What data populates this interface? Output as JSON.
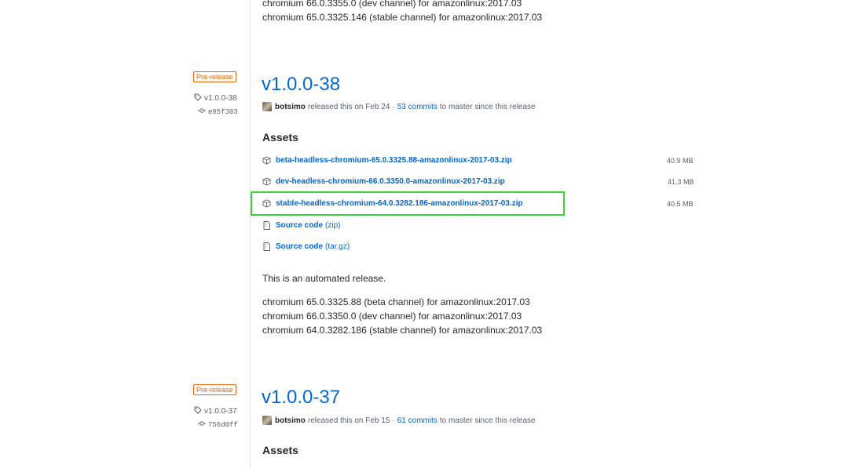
{
  "top_notes": {
    "line1": "chromium 66.0.3355.0 (dev channel) for amazonlinux:2017.03",
    "line2": "chromium 65.0.3325.146 (stable channel) for amazonlinux:2017.03"
  },
  "releases": [
    {
      "badge": "Pre-release",
      "tag": "v1.0.0-38",
      "commit": "e95f303",
      "title": "v1.0.0-38",
      "author": "botsimo",
      "released_text": "released this on Feb 24",
      "separator": "·",
      "commits_link": "53 commits",
      "since_text": "to master since this release",
      "assets_heading": "Assets",
      "assets": [
        {
          "name": "beta-headless-chromium-65.0.3325.88-amazonlinux-2017-03.zip",
          "size": "40.9 MB",
          "icon": "package-icon"
        },
        {
          "name": "dev-headless-chromium-66.0.3350.0-amazonlinux-2017-03.zip",
          "size": "41.3 MB",
          "icon": "package-icon"
        },
        {
          "name": "stable-headless-chromium-64.0.3282.186-amazonlinux-2017-03.zip",
          "size": "40.5 MB",
          "icon": "package-icon"
        }
      ],
      "source_code": [
        {
          "label": "Source code",
          "format": "(zip)",
          "icon": "file-zip-icon"
        },
        {
          "label": "Source code",
          "format": "(tar.gz)",
          "icon": "file-zip-icon"
        }
      ],
      "description": "This is an automated release.",
      "notes": [
        "chromium 65.0.3325.88 (beta channel) for amazonlinux:2017.03",
        "chromium 66.0.3350.0 (dev channel) for amazonlinux:2017.03",
        "chromium 64.0.3282.186 (stable channel) for amazonlinux:2017.03"
      ]
    },
    {
      "badge": "Pre-release",
      "tag": "v1.0.0-37",
      "commit": "756d0ff",
      "title": "v1.0.0-37",
      "author": "botsimo",
      "released_text": "released this on Feb 15",
      "separator": "·",
      "commits_link": "61 commits",
      "since_text": "to master since this release",
      "assets_heading": "Assets"
    }
  ],
  "colors": {
    "link": "#0366d6",
    "prerelease": "#e36209",
    "highlight": "#3bd43b"
  }
}
